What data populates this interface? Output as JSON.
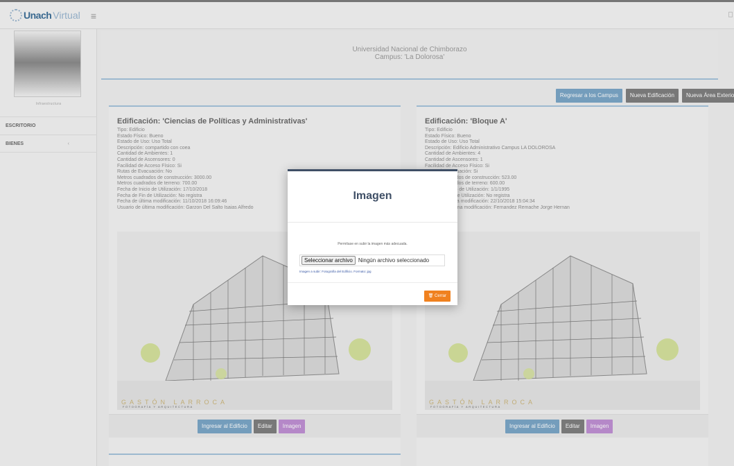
{
  "brand": {
    "bold": "Unach",
    "light": "Virtual"
  },
  "topbar": {
    "menu_glyph": "≡"
  },
  "sidebar": {
    "avatar_caption": "Infraestructura",
    "items": [
      {
        "label": "ESCRITORIO",
        "caret": ""
      },
      {
        "label": "BIENES",
        "caret": "‹"
      }
    ]
  },
  "header": {
    "university": "Universidad Nacional de Chimborazo",
    "campus": "Campus: 'La Dolorosa'"
  },
  "actions": {
    "back": "Regresar a los Campus",
    "new_building": "Nueva Edificación",
    "new_area": "Nueva Área Exterior"
  },
  "cards": [
    {
      "title": "Edificación: 'Ciencias de Políticas y Administrativas'",
      "details": [
        "Tipo: Edificio",
        "Estado Físico: Bueno",
        "Estado de Uso: Uso Total",
        "Descripción: compartido con coea",
        "Cantidad de Ambientes: 1",
        "Cantidad de Ascensores: 0",
        "Facilidad de Acceso Físico: Si",
        "Rutas de Evacuación: No",
        "Metros cuadrados de construcción: 3000.00",
        "Metros cuadrados de terreno: 700.00",
        "Fecha de Inicio de Utilización: 17/10/2018",
        "Fecha de Fin de Utilización: No registra",
        "Fecha de última modificación: 11/10/2018 16:09:46",
        "Usuario de última modificación: Garzon Del Salto Isaias Alfredo"
      ],
      "image_caption": "GASTÓN LARROCA",
      "image_subcaption": "FOTOGRAFÍA Y ARQUITECTURA",
      "buttons": {
        "enter": "Ingresar al Edificio",
        "edit": "Editar",
        "image": "Imagen"
      }
    },
    {
      "title": "Edificación: 'Bloque A'",
      "details": [
        "Tipo: Edificio",
        "Estado Físico: Bueno",
        "Estado de Uso: Uso Total",
        "Descripción: Edificio Administrativo Campus LA DOLOROSA",
        "Cantidad de Ambientes: 4",
        "Cantidad de Ascensores: 1",
        "Facilidad de Acceso Físico: Si",
        "Rutas de Evacuación: Si",
        "Metros cuadrados de construcción: 523.00",
        "Metros cuadrados de terreno: 600.00",
        "Fecha de Inicio de Utilización: 1/1/1995",
        "Fecha de Fin de Utilización: No registra",
        "Fecha de última modificación: 22/10/2018 15:04:34",
        "Usuario de última modificación: Fernandez Remache Jorge Hernan"
      ],
      "image_caption": "GASTÓN LARROCA",
      "image_subcaption": "FOTOGRAFÍA Y ARQUITECTURA",
      "buttons": {
        "enter": "Ingresar al Edificio",
        "edit": "Editar",
        "image": "Imagen"
      }
    }
  ],
  "modal": {
    "title": "Imagen",
    "instruction": "Permítase en subir la imagen más adecuada.",
    "file_button": "Seleccionar archivo",
    "file_status": "Ningún archivo seleccionado",
    "hint": "Imagen a subir: Fotografía del Edificio. Formato: jpg",
    "close_icon": "🗑",
    "close_label": "Cerrar"
  }
}
